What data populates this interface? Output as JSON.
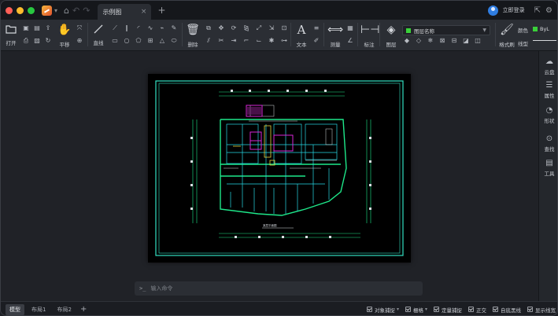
{
  "titlebar": {
    "tab_title": "示例图",
    "login_label": "立即登录"
  },
  "ribbon": {
    "open": "打开",
    "pan": "平移",
    "line": "直线",
    "delete": "删除",
    "text": "文本",
    "measure": "测量",
    "annotate": "标注",
    "layer": "图层",
    "layer_name": "图层名称",
    "format_brush": "格式刷",
    "color": "颜色",
    "color_value": "ByL",
    "linetype": "线型"
  },
  "right_panel": [
    {
      "label": "云盘",
      "icon": "cloud-icon"
    },
    {
      "label": "属性",
      "icon": "properties-icon"
    },
    {
      "label": "形状",
      "icon": "shapes-icon"
    },
    {
      "label": "查找",
      "icon": "find-icon"
    },
    {
      "label": "工具",
      "icon": "toolbox-icon"
    }
  ],
  "command": {
    "prompt": ">_",
    "placeholder": "输入命令"
  },
  "status": {
    "tabs": [
      "模型",
      "布局1",
      "布局2"
    ],
    "options": [
      "对象捕捉",
      "栅格",
      "定量捕捉",
      "正交",
      "自底黑线",
      "显示线宽"
    ]
  },
  "drawing": {
    "title_block_text": "某层平面图",
    "colors": {
      "frame": "#33e0c2",
      "wall": "#1ee88a",
      "cyan": "#27d9e6",
      "magenta": "#d626d6",
      "yellow": "#e6d23a",
      "white": "#d9dde2"
    }
  }
}
